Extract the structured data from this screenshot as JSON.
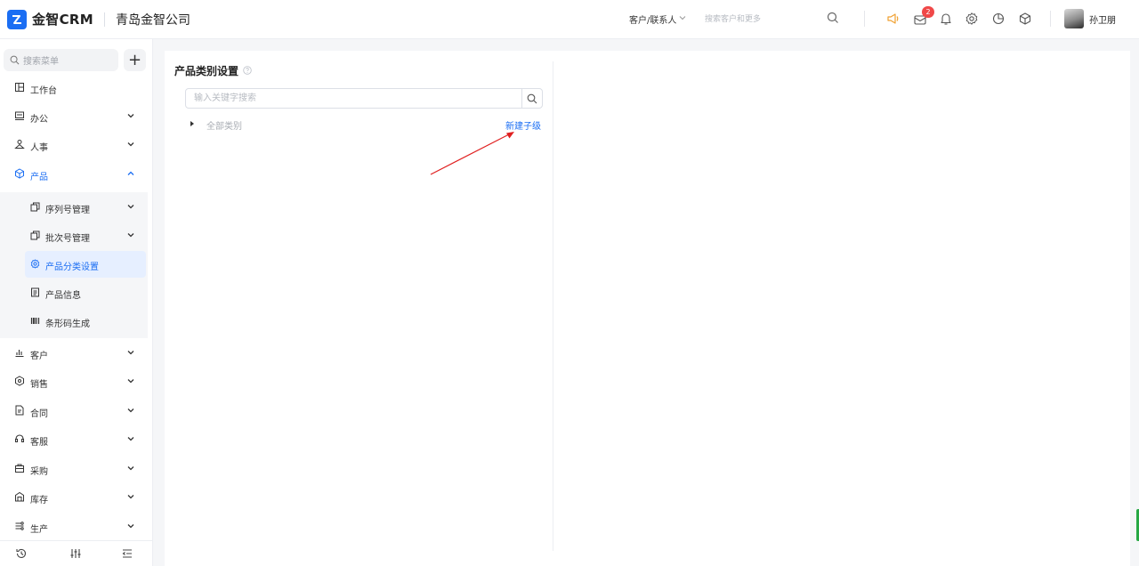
{
  "header": {
    "brand": "金智CRM",
    "company": "青岛金智公司",
    "scope_label": "客户/联系人",
    "search_placeholder": "搜索客户和更多",
    "notification_count": "2",
    "username": "孙卫朋",
    "icons": [
      "search-icon",
      "megaphone-icon",
      "message-icon",
      "bell-icon",
      "gear-icon",
      "pie-chart-icon",
      "cube-icon"
    ]
  },
  "sidebar": {
    "search_placeholder": "搜索菜单",
    "add_label": "+",
    "items": [
      {
        "label": "工作台",
        "icon": "dashboard-icon"
      },
      {
        "label": "办公",
        "icon": "office-icon"
      },
      {
        "label": "人事",
        "icon": "people-icon"
      },
      {
        "label": "产品",
        "icon": "cube-icon"
      },
      {
        "label": "客户",
        "icon": "chart-icon"
      },
      {
        "label": "销售",
        "icon": "hexagon-icon"
      },
      {
        "label": "合同",
        "icon": "document-icon"
      },
      {
        "label": "客服",
        "icon": "headset-icon"
      },
      {
        "label": "采购",
        "icon": "shopping-icon"
      },
      {
        "label": "库存",
        "icon": "warehouse-icon"
      },
      {
        "label": "生产",
        "icon": "production-icon"
      }
    ],
    "product_submenu": [
      {
        "label": "序列号管理",
        "icon": "copy-icon"
      },
      {
        "label": "批次号管理",
        "icon": "copy-icon"
      },
      {
        "label": "产品分类设置",
        "icon": "gear-icon"
      },
      {
        "label": "产品信息",
        "icon": "list-icon"
      },
      {
        "label": "条形码生成",
        "icon": "barcode-icon"
      }
    ],
    "footer_icons": [
      "history-icon",
      "sliders-icon",
      "collapse-icon"
    ]
  },
  "main": {
    "title": "产品类别设置",
    "keyword_placeholder": "输入关键字搜索",
    "tree_root": "全部类别",
    "new_child_label": "新建子级"
  },
  "colors": {
    "accent": "#1b6ef3",
    "badge": "#f04848",
    "annotation_arrow": "#e02020"
  }
}
